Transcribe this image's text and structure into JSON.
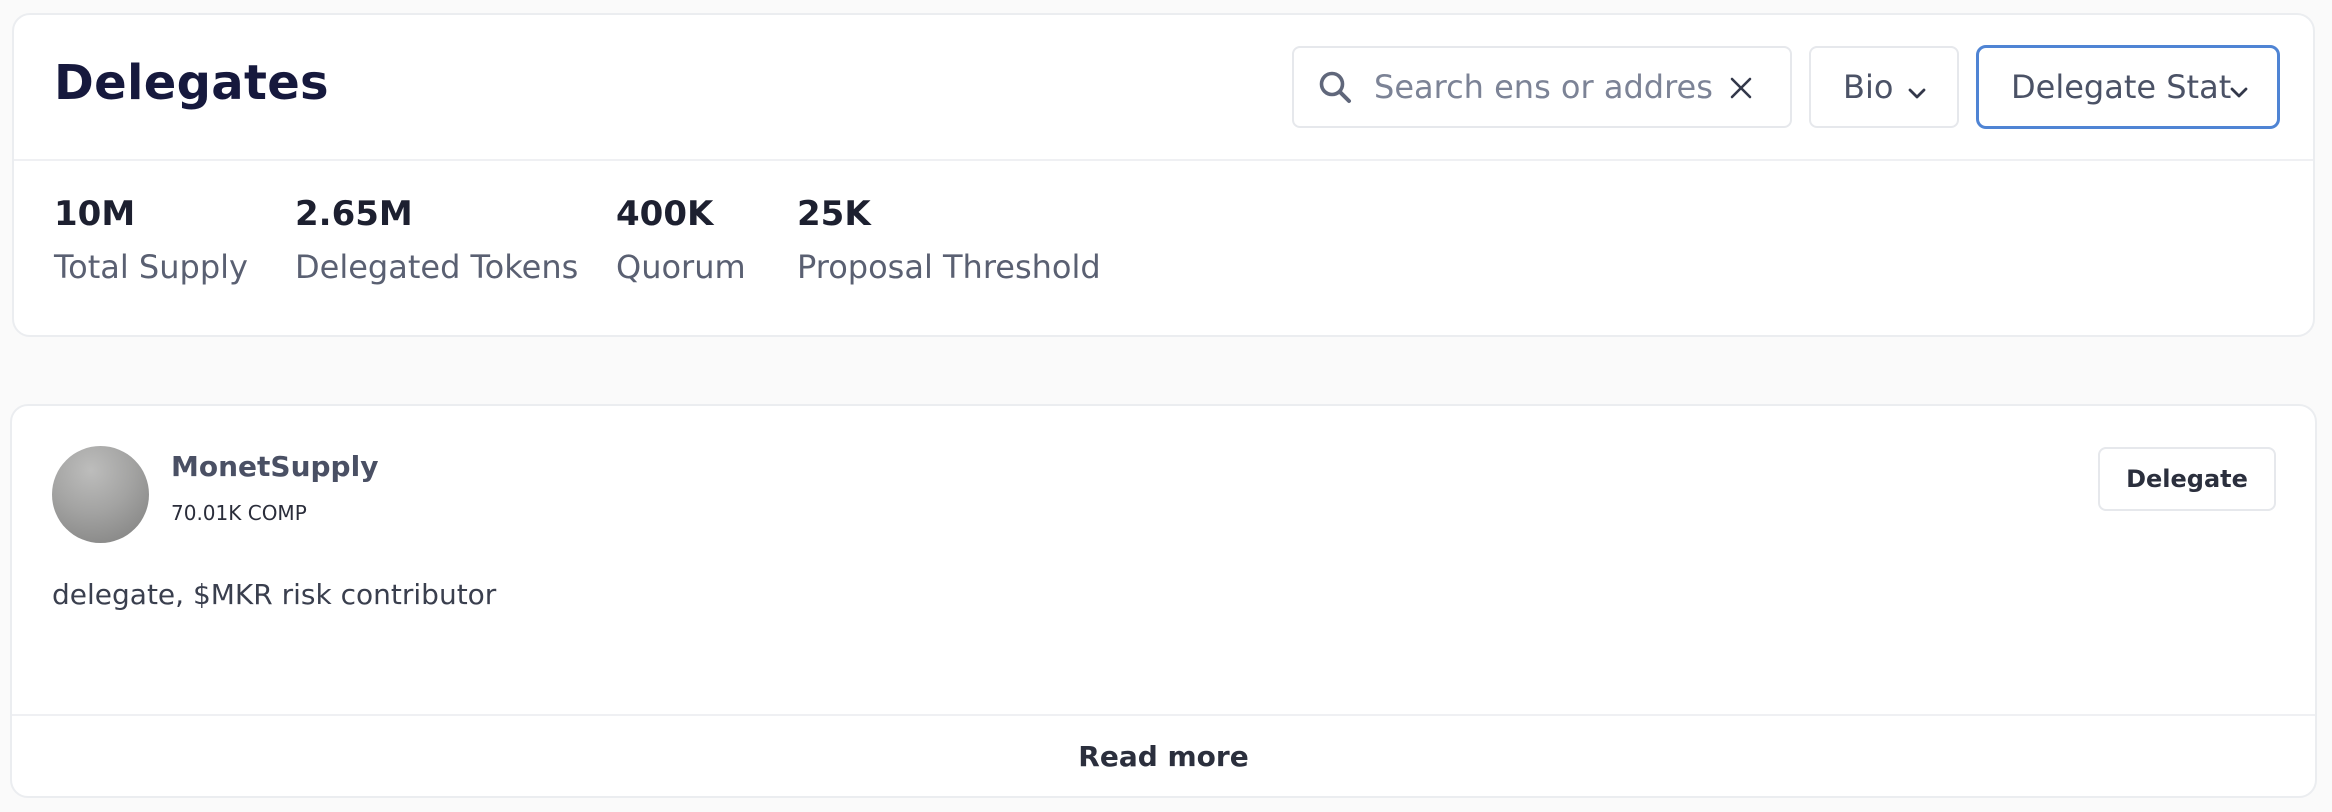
{
  "header": {
    "title": "Delegates",
    "search": {
      "placeholder": "Search ens or address",
      "value": ""
    },
    "filters": {
      "bio_label": "Bio",
      "status_label": "Delegate Stat"
    },
    "icons": {
      "search": "search-icon",
      "clear": "close-icon",
      "dropdown": "chevron-down-icon"
    }
  },
  "stats": [
    {
      "value": "10M",
      "label": "Total Supply"
    },
    {
      "value": "2.65M",
      "label": "Delegated Tokens"
    },
    {
      "value": "400K",
      "label": "Quorum"
    },
    {
      "value": "25K",
      "label": "Proposal Threshold"
    }
  ],
  "delegates": [
    {
      "name": "MonetSupply",
      "voting_power": "70.01K COMP",
      "bio": "delegate, $MKR risk contributor",
      "delegate_button_label": "Delegate",
      "read_more_label": "Read more"
    }
  ],
  "colors": {
    "accent_focus": "#4f84d4",
    "title": "#16193d",
    "muted_text": "#5a6072",
    "border": "#ebedf0"
  }
}
